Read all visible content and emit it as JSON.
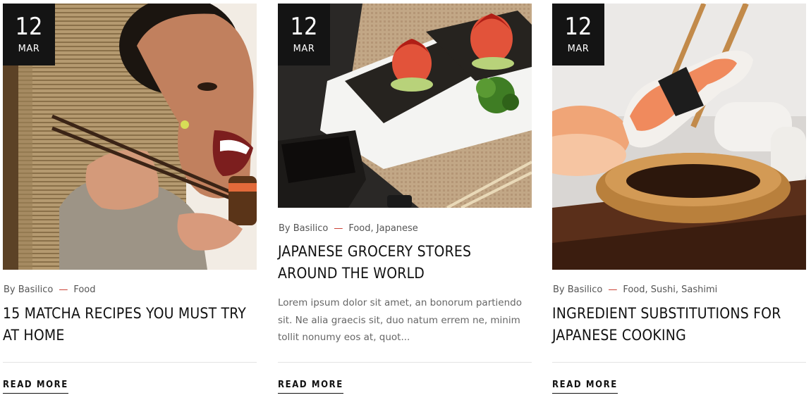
{
  "posts": [
    {
      "date_day": "12",
      "date_month": "MAR",
      "image_alt": "Woman eating sushi with chopsticks",
      "author": "By Basilico",
      "separator": "—",
      "categories": "Food",
      "title": "15 Matcha Recipes You Must Try At Home",
      "excerpt": "",
      "read_more": "READ MORE"
    },
    {
      "date_day": "12",
      "date_month": "MAR",
      "image_alt": "Salmon sushi bites on a plate",
      "author": "By Basilico",
      "separator": "—",
      "categories": "Food, Japanese",
      "title": "Japanese Grocery Stores Around The World",
      "excerpt": "Lorem ipsum dolor sit amet, an bonorum partiendo sit. Ne alia graecis sit, duo natum errem ne, minim tollit nonumy eos at, quot...",
      "read_more": "READ MORE"
    },
    {
      "date_day": "12",
      "date_month": "MAR",
      "image_alt": "Shrimp nigiri held by chopsticks over soy sauce",
      "author": "By Basilico",
      "separator": "—",
      "categories": "Food, Sushi, Sashimi",
      "title": "Ingredient Substitutions For Japanese Cooking",
      "excerpt": "",
      "read_more": "READ MORE"
    }
  ],
  "colors": {
    "badge_bg": "#141414",
    "accent_separator": "#c9372c",
    "title_text": "#111111",
    "meta_text": "#555555"
  }
}
